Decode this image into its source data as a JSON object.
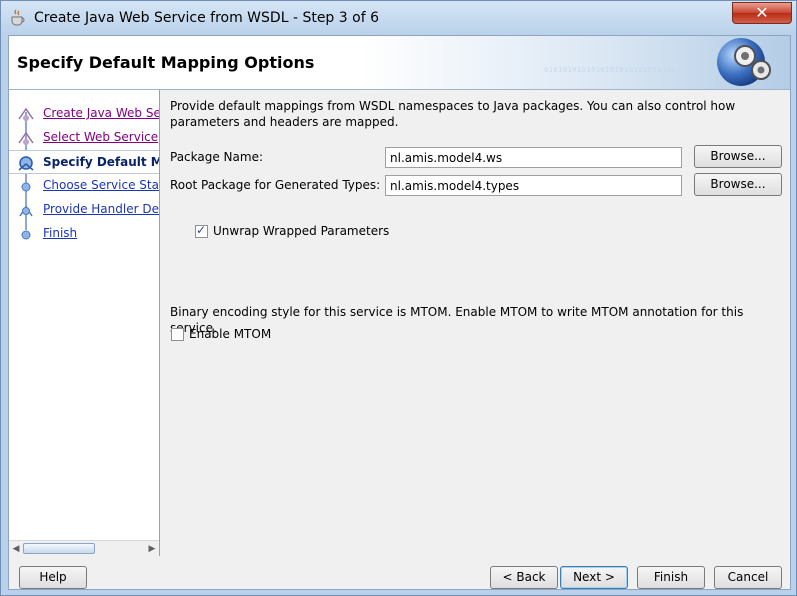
{
  "window": {
    "title": "Create Java Web Service from WSDL - Step 3 of 6",
    "close_glyph": "✕"
  },
  "header": {
    "title": "Specify Default Mapping Options",
    "decoration": "0101010101010101010101010101"
  },
  "nav": {
    "items": [
      {
        "label": "Create Java Web Se",
        "state": "visited"
      },
      {
        "label": "Select Web Service",
        "state": "visited"
      },
      {
        "label": "Specify Default Ma",
        "state": "current"
      },
      {
        "label": "Choose Service Stat",
        "state": "link"
      },
      {
        "label": "Provide Handler Deta",
        "state": "link"
      },
      {
        "label": "Finish",
        "state": "link"
      }
    ]
  },
  "content": {
    "description": "Provide default mappings from WSDL namespaces to Java packages. You can also control how parameters and headers are mapped.",
    "package_name_label": "Package Name:",
    "package_name_value": "nl.amis.model4.ws",
    "root_package_label": "Root Package for Generated Types:",
    "root_package_value": "nl.amis.model4.types",
    "browse_label": "Browse...",
    "unwrap_label": "Unwrap Wrapped Parameters",
    "unwrap_checked": true,
    "mtom_info": "Binary encoding style for this service is MTOM. Enable MTOM to write MTOM annotation for this service.",
    "mtom_label": "Enable MTOM",
    "mtom_checked": false
  },
  "footer": {
    "help_label": "Help",
    "back_label": "< Back",
    "next_label": "Next >",
    "finish_label": "Finish",
    "cancel_label": "Cancel"
  },
  "colors": {
    "link": "#1a35b8",
    "visited": "#800080",
    "current": "#0a246a",
    "close": "#c8442f"
  }
}
